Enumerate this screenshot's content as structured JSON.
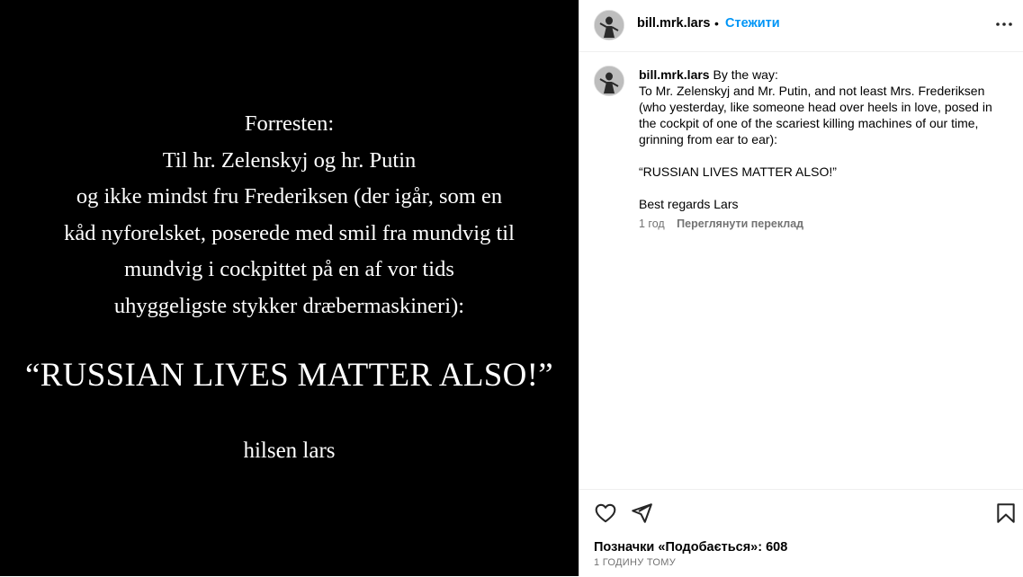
{
  "image": {
    "lines": [
      "Forresten:",
      "Til hr. Zelenskyj og hr. Putin",
      "og ikke mindst fru Frederiksen (der igår, som en",
      "kåd nyforelsket, poserede med smil fra mundvig til",
      "mundvig i cockpittet på en af vor tids",
      "uhyggeligste stykker dræbermaskineri):"
    ],
    "slogan": "“RUSSIAN LIVES MATTER ALSO!”",
    "signoff": "hilsen lars"
  },
  "header": {
    "username": "bill.mrk.lars",
    "separator": "•",
    "follow_label": "Стежити",
    "more_icon": "more-horizontal-icon"
  },
  "caption": {
    "username": "bill.mrk.lars",
    "intro": "By the way:",
    "body": "To Mr. Zelenskyj and Mr. Putin, and not least Mrs. Frederiksen (who yesterday, like someone head over heels in love, posed in the cockpit of one of the scariest killing machines of our time, grinning from ear to ear):",
    "slogan": "“RUSSIAN LIVES MATTER ALSO!”",
    "signoff": "Best regards Lars",
    "age": "1 год",
    "translate_label": "Переглянути переклад"
  },
  "actions": {
    "like_icon": "heart-icon",
    "share_icon": "send-icon",
    "save_icon": "bookmark-icon",
    "likes_text": "Позначки «Подобається»: 608",
    "timestamp": "1 ГОДИНУ ТОМУ"
  },
  "colors": {
    "accent": "#0095f6",
    "muted": "#737373",
    "image_bg": "#000000"
  }
}
